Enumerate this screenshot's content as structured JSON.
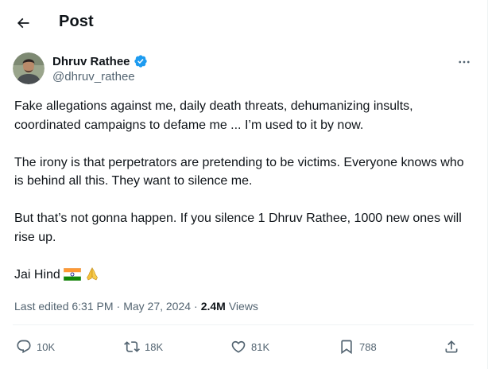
{
  "header": {
    "title": "Post"
  },
  "author": {
    "name": "Dhruv Rathee",
    "handle": "@dhruv_rathee",
    "verified": true
  },
  "tweet": {
    "paragraphs": [
      "Fake allegations against me, daily death threats, dehumanizing insults, coordinated campaigns to defame me ... I’m used to it by now.",
      "The irony is that perpetrators are pretending to be victims. Everyone knows who is behind all this. They want to silence me.",
      "But that’s not gonna happen. If you silence 1 Dhruv Rathee, 1000 new ones will rise up."
    ],
    "closing": "Jai Hind",
    "closing_emojis": [
      "india-flag",
      "folded-hands"
    ]
  },
  "meta": {
    "edited_label": "Last edited 6:31 PM",
    "separator": "·",
    "date": "May 27, 2024",
    "views_count": "2.4M",
    "views_label": "Views"
  },
  "actions": {
    "replies": "10K",
    "reposts": "18K",
    "likes": "81K",
    "bookmarks": "788"
  },
  "icons": {
    "back": "arrow-left-icon",
    "verified": "verified-badge-icon",
    "more": "more-horizontal-icon",
    "reply": "reply-icon",
    "repost": "repost-icon",
    "like": "heart-icon",
    "bookmark": "bookmark-icon",
    "share": "share-icon"
  },
  "colors": {
    "text_primary": "#0f1419",
    "text_secondary": "#536471",
    "verified": "#1d9bf0",
    "divider": "#eff3f4"
  }
}
